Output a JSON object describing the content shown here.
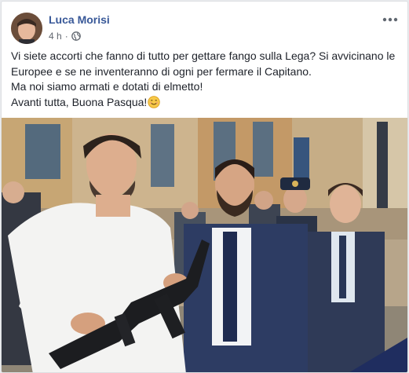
{
  "post": {
    "author": "Luca Morisi",
    "time": "4 h",
    "separator": "·",
    "audience_icon": "globe-icon",
    "menu_icon": "more-options-icon",
    "text_lines": [
      "Vi siete accorti che fanno di tutto per gettare fango sulla Lega? Si avvicinano le",
      "Europee e se ne inventeranno di ogni per fermare il Capitano.",
      "Ma noi siamo armati e dotati di elmetto!",
      "Avanti tutta, Buona Pasqua!"
    ],
    "emoji_icon": "smiling-face-icon"
  },
  "colors": {
    "author": "#385898",
    "meta": "#616770",
    "text": "#1d2129",
    "background": "#e9ebee"
  }
}
